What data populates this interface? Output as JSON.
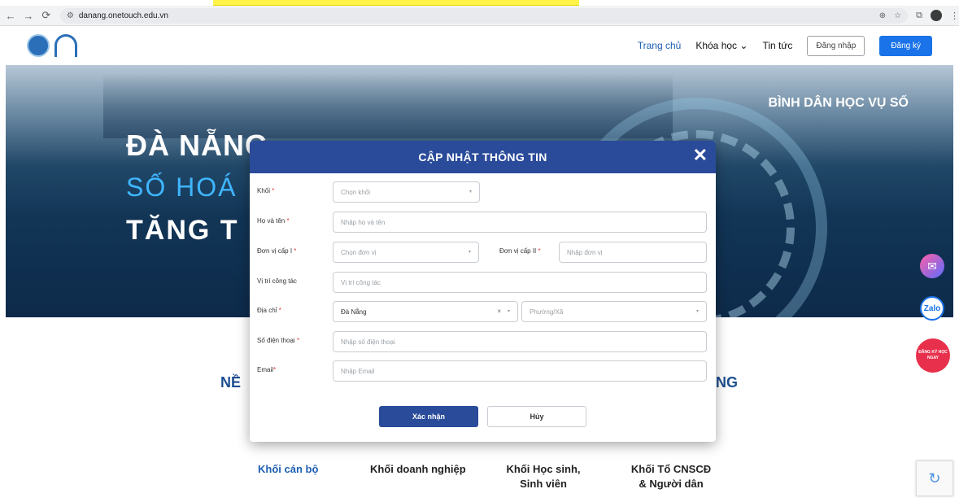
{
  "browser": {
    "url": "danang.onetouch.edu.vn",
    "zoom_icon": "zoom-icon",
    "star_icon": "star-icon"
  },
  "header": {
    "nav": [
      "Trang chủ",
      "Khóa học ⌄",
      "Tin tức"
    ],
    "login_label": "Đăng nhập",
    "register_label": "Đăng ký"
  },
  "hero": {
    "title1": "ĐÀ NẴNG",
    "title2": "SỐ HOÁ",
    "title3": "TĂNG T",
    "right_title": "BÌNH DÂN HỌC VỤ SỐ"
  },
  "section": {
    "title_left": "NỀ",
    "title_right": "NG",
    "blocks": [
      "Khối cán bộ",
      "Khối doanh nghiệp",
      "Khối Học sinh, Sinh viên",
      "Khối Tổ CNSCĐ & Người dân"
    ]
  },
  "widgets": {
    "zalo": "Zalo",
    "register_now": "ĐĂNG KÝ HỌC NGAY"
  },
  "modal": {
    "title": "CẬP NHẬT THÔNG TIN",
    "close": "✕",
    "fields": {
      "khoi": {
        "label": "Khối",
        "placeholder": "Chọn khối"
      },
      "hoten": {
        "label": "Họ và tên",
        "placeholder": "Nhập họ và tên"
      },
      "donvi1": {
        "label": "Đơn vị cấp I",
        "placeholder": "Chọn đơn vị"
      },
      "donvi2": {
        "label": "Đơn vị cấp II",
        "placeholder": "Nhập đơn vị"
      },
      "vitri": {
        "label": "Vị trí công tác",
        "placeholder": "Vị trí công tác"
      },
      "diachi": {
        "label": "Địa chỉ",
        "value": "Đà Nẵng",
        "ward_placeholder": "Phường/Xã"
      },
      "sdt": {
        "label": "Số điện thoại",
        "placeholder": "Nhập số điện thoại"
      },
      "email": {
        "label": "Email",
        "placeholder": "Nhập Email"
      }
    },
    "confirm_label": "Xác nhận",
    "cancel_label": "Hủy"
  }
}
